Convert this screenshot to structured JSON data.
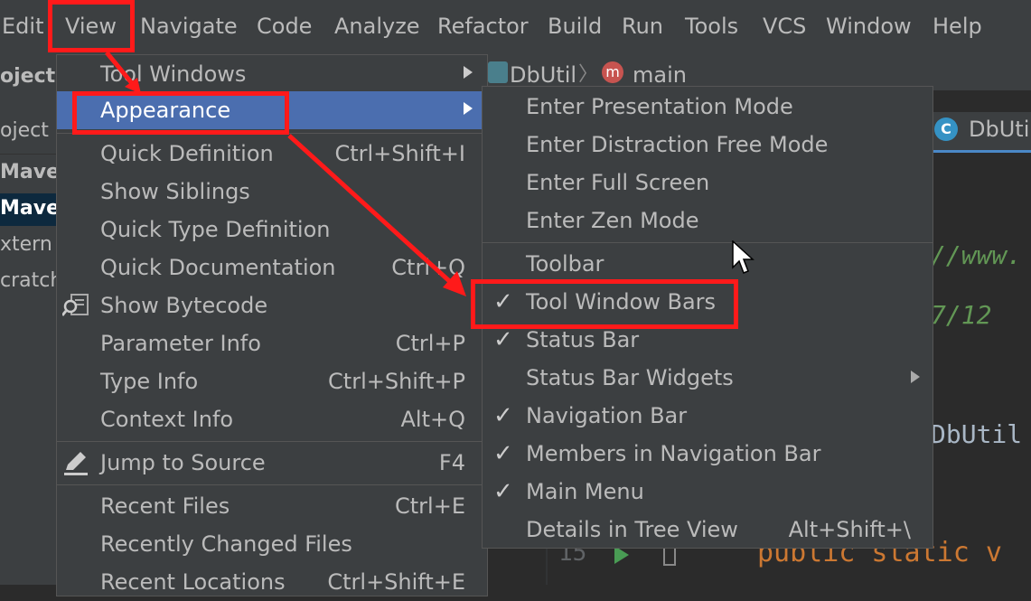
{
  "menubar": {
    "items": [
      "Edit",
      "View",
      "Navigate",
      "Code",
      "Analyze",
      "Refactor",
      "Build",
      "Run",
      "Tools",
      "VCS",
      "Window",
      "Help"
    ]
  },
  "left_panel": {
    "items": [
      "oject",
      "oject",
      "Maven",
      "Maven",
      "xtern",
      "cratch"
    ]
  },
  "navbar": {
    "file": "DbUtil",
    "method_icon": "m",
    "method": "main",
    "separator": "〉"
  },
  "editor": {
    "tab_label": "DbUtil",
    "tab_icon": "C",
    "code_fragments": [
      "//www.",
      "7/12",
      "DbUtil",
      "public static v"
    ],
    "line_number": "15"
  },
  "view_menu": {
    "items": [
      {
        "label": "Tool Windows",
        "shortcut": "",
        "submenu": true
      },
      {
        "label": "Appearance",
        "shortcut": "",
        "submenu": true,
        "selected": true
      },
      {
        "label": "Quick Definition",
        "shortcut": "Ctrl+Shift+I"
      },
      {
        "label": "Show Siblings",
        "shortcut": ""
      },
      {
        "label": "Quick Type Definition",
        "shortcut": ""
      },
      {
        "label": "Quick Documentation",
        "shortcut": "Ctrl+Q"
      },
      {
        "label": "Show Bytecode",
        "shortcut": ""
      },
      {
        "label": "Parameter Info",
        "shortcut": "Ctrl+P"
      },
      {
        "label": "Type Info",
        "shortcut": "Ctrl+Shift+P"
      },
      {
        "label": "Context Info",
        "shortcut": "Alt+Q"
      },
      {
        "label": "Jump to Source",
        "shortcut": "F4"
      },
      {
        "label": "Recent Files",
        "shortcut": "Ctrl+E"
      },
      {
        "label": "Recently Changed Files",
        "shortcut": ""
      },
      {
        "label": "Recent Locations",
        "shortcut": "Ctrl+Shift+E"
      }
    ]
  },
  "appearance_menu": {
    "items": [
      {
        "label": "Enter Presentation Mode",
        "checked": false
      },
      {
        "label": "Enter Distraction Free Mode",
        "checked": false
      },
      {
        "label": "Enter Full Screen",
        "checked": false
      },
      {
        "label": "Enter Zen Mode",
        "checked": false
      },
      {
        "label": "Toolbar",
        "checked": false
      },
      {
        "label": "Tool Window Bars",
        "checked": true
      },
      {
        "label": "Status Bar",
        "checked": true
      },
      {
        "label": "Status Bar Widgets",
        "checked": false,
        "submenu": true
      },
      {
        "label": "Navigation Bar",
        "checked": true
      },
      {
        "label": "Members in Navigation Bar",
        "checked": true
      },
      {
        "label": "Main Menu",
        "checked": true
      },
      {
        "label": "Details in Tree View",
        "checked": false,
        "shortcut": "Alt+Shift+\\"
      }
    ],
    "check_glyph": "✓"
  },
  "colors": {
    "accent": "#4b6eaf",
    "annotation": "#ff1a1a",
    "code_green": "#629755",
    "code_orange": "#cc7832"
  },
  "icons": {
    "bytecode": "magnifier-bytecode-icon",
    "jump": "pencil-icon",
    "cursor": "mouse-pointer-icon",
    "run": "run-arrow-icon"
  }
}
